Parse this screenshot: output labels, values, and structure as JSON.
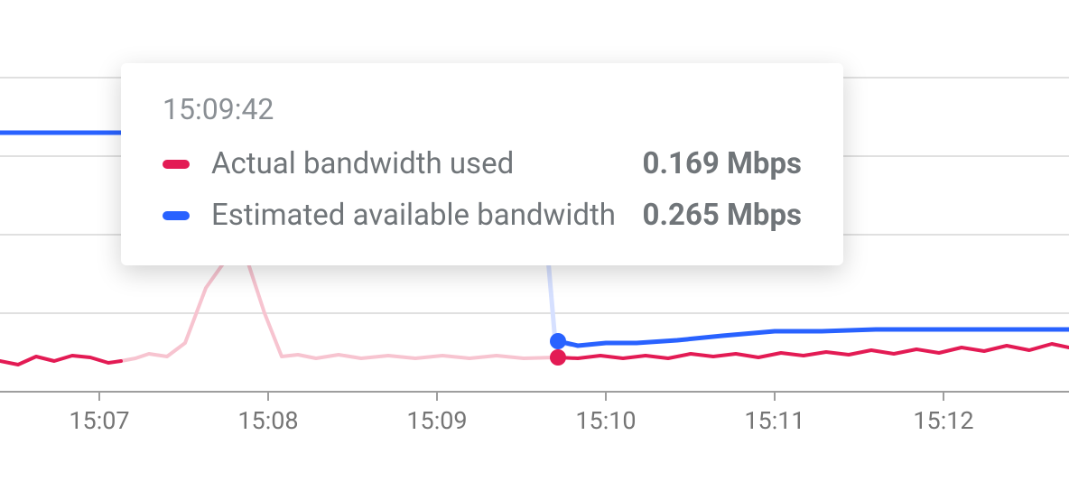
{
  "chart_data": {
    "type": "line",
    "xlabel": "",
    "ylabel": "",
    "x_ticks": [
      "15:07",
      "15:08",
      "15:09",
      "15:10",
      "15:11",
      "15:12"
    ],
    "y_grid_values": [
      0.2,
      0.4,
      0.6,
      0.8
    ],
    "series": [
      {
        "name": "Actual bandwidth used",
        "color": "#e31b54",
        "x": [
          "15:06:30",
          "15:06:36",
          "15:06:42",
          "15:06:48",
          "15:06:54",
          "15:07:00",
          "15:07:06",
          "15:07:12",
          "15:07:18",
          "15:07:24",
          "15:07:30",
          "15:07:36",
          "15:07:42",
          "15:07:48",
          "15:07:54",
          "15:08:00",
          "15:08:06",
          "15:08:12",
          "15:08:18",
          "15:08:24",
          "15:08:30",
          "15:08:36",
          "15:08:42",
          "15:08:48",
          "15:08:54",
          "15:09:00",
          "15:09:06",
          "15:09:12",
          "15:09:18",
          "15:09:24",
          "15:09:30",
          "15:09:36",
          "15:09:42",
          "15:09:48",
          "15:09:54",
          "15:10:00",
          "15:10:06",
          "15:10:12",
          "15:10:18",
          "15:10:24",
          "15:10:30",
          "15:10:36",
          "15:10:42",
          "15:10:48",
          "15:10:54",
          "15:11:00",
          "15:11:06",
          "15:11:12",
          "15:11:18",
          "15:11:24",
          "15:11:30",
          "15:11:36",
          "15:11:42",
          "15:11:48",
          "15:11:54",
          "15:12:00",
          "15:12:06",
          "15:12:12",
          "15:12:18",
          "15:12:24",
          "15:12:30"
        ],
        "values": [
          0.155,
          0.145,
          0.165,
          0.155,
          0.17,
          0.165,
          0.15,
          0.17,
          0.155,
          0.16,
          0.19,
          0.28,
          0.35,
          0.33,
          0.2,
          0.17,
          0.18,
          0.165,
          0.175,
          0.17,
          0.175,
          0.18,
          0.165,
          0.175,
          0.17,
          0.175,
          0.165,
          0.175,
          0.17,
          0.165,
          0.17,
          0.165,
          0.169,
          0.17,
          0.17,
          0.175,
          0.17,
          0.175,
          0.17,
          0.18,
          0.17,
          0.175,
          0.18,
          0.175,
          0.18,
          0.175,
          0.18,
          0.18,
          0.185,
          0.18,
          0.185,
          0.18,
          0.185,
          0.19,
          0.185,
          0.19,
          0.2,
          0.185,
          0.2,
          0.19,
          0.2
        ]
      },
      {
        "name": "Estimated available bandwidth",
        "color": "#2962ff",
        "x": [
          "15:06:30",
          "15:07:30",
          "15:09:36",
          "15:09:42",
          "15:09:48",
          "15:09:54",
          "15:10:00",
          "15:10:12",
          "15:10:30",
          "15:10:42",
          "15:11:00",
          "15:11:12",
          "15:11:30",
          "15:12:00",
          "15:12:30"
        ],
        "values": [
          0.92,
          0.92,
          0.92,
          0.265,
          0.25,
          0.265,
          0.27,
          0.27,
          0.275,
          0.28,
          0.29,
          0.29,
          0.295,
          0.295,
          0.295
        ]
      }
    ],
    "hover": {
      "time": "15:09:42",
      "actual_label": "Actual bandwidth used",
      "actual_value": "0.169 Mbps",
      "est_label": "Estimated available bandwidth",
      "est_value": "0.265 Mbps"
    }
  }
}
